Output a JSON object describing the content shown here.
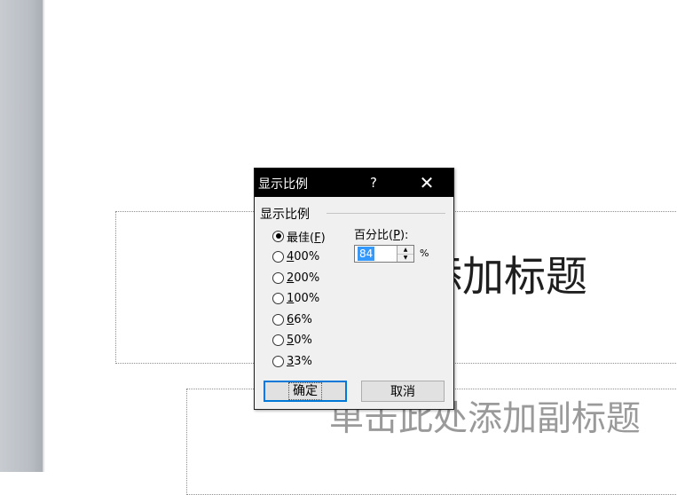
{
  "slide": {
    "title_placeholder": "单击此处添加标题",
    "subtitle_placeholder": "单击此处添加副标题"
  },
  "dialog": {
    "title": "显示比例",
    "help_label": "?",
    "close_label": "✕",
    "group_label": "显示比例",
    "options": [
      {
        "label": "最佳",
        "key": "F",
        "checked": true
      },
      {
        "label": "400%",
        "key": "4",
        "rest": "00%",
        "checked": false
      },
      {
        "label": "200%",
        "key": "2",
        "rest": "00%",
        "checked": false
      },
      {
        "label": "100%",
        "key": "1",
        "rest": "00%",
        "checked": false
      },
      {
        "label": "66%",
        "key": "6",
        "rest": "6%",
        "checked": false
      },
      {
        "label": "50%",
        "key": "5",
        "rest": "0%",
        "checked": false
      },
      {
        "label": "33%",
        "key": "3",
        "rest": "3%",
        "checked": false
      }
    ],
    "percent_label": "百分比",
    "percent_key": "P",
    "percent_value": "84",
    "percent_unit": "%",
    "ok_label": "确定",
    "cancel_label": "取消"
  }
}
